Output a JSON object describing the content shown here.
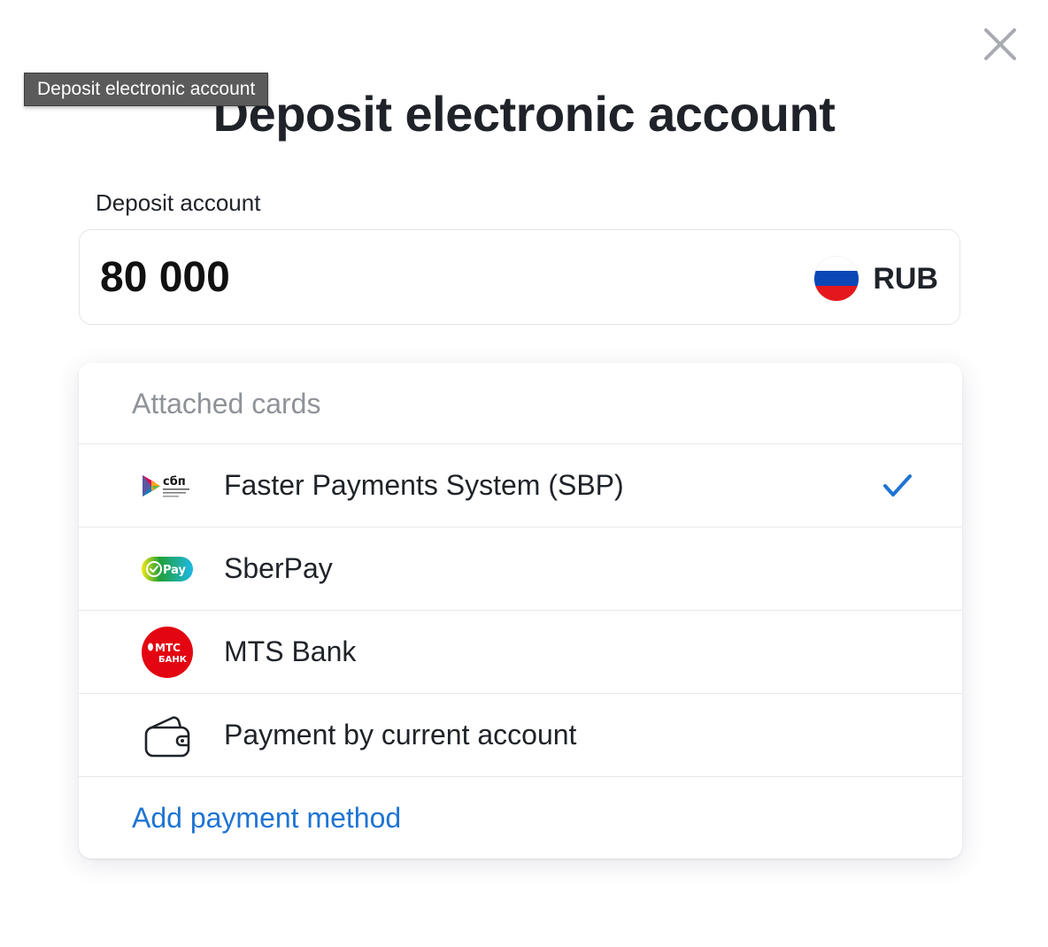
{
  "dialog": {
    "title": "Deposit electronic account",
    "tooltip": "Deposit electronic account"
  },
  "deposit": {
    "label": "Deposit account",
    "amount": "80 000",
    "currency": "RUB"
  },
  "payment_methods": {
    "header": "Attached cards",
    "options": [
      {
        "label": "Faster Payments System (SBP)",
        "icon": "sbp-logo-icon",
        "selected": true,
        "logo_text": "сбп"
      },
      {
        "label": "SberPay",
        "icon": "sberpay-logo-icon",
        "selected": false,
        "logo_text": "Pay"
      },
      {
        "label": "MTS Bank",
        "icon": "mts-bank-logo-icon",
        "selected": false,
        "logo_text": "МТС",
        "logo_subtext": "БАНК"
      },
      {
        "label": "Payment by current account",
        "icon": "wallet-icon",
        "selected": false
      }
    ],
    "add_label": "Add payment method"
  },
  "colors": {
    "accent": "#1f74d4",
    "check": "#1f74d4",
    "mts_red": "#e30611",
    "sber_green": "#21a038"
  }
}
